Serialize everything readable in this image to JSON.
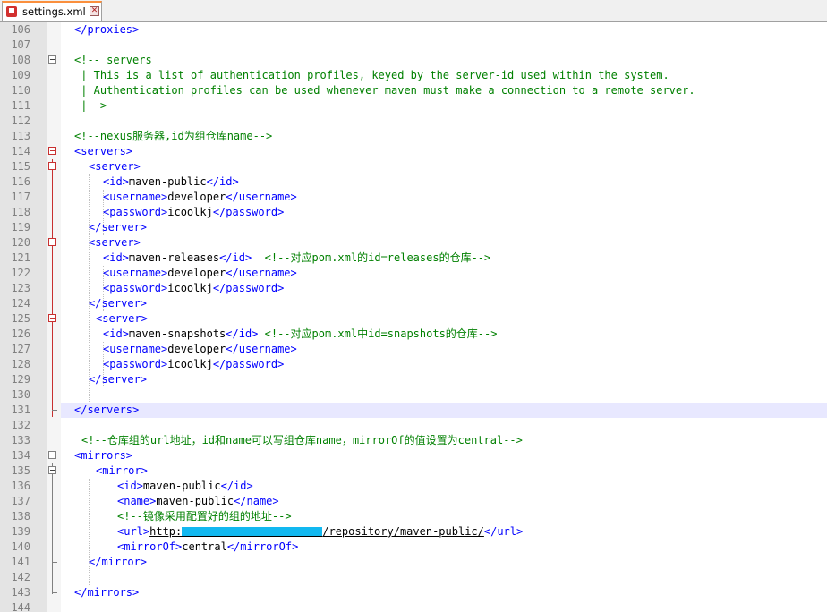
{
  "tab": {
    "filename": "settings.xml",
    "close_glyph": "✕"
  },
  "lines": {
    "106": {
      "num": "106",
      "a": "</proxies>"
    },
    "107": {
      "num": "107"
    },
    "108": {
      "num": "108",
      "a": "<!-- servers"
    },
    "109": {
      "num": "109",
      "a": " | This is a list of authentication profiles, keyed by the server-id used within the system."
    },
    "110": {
      "num": "110",
      "a": " | Authentication profiles can be used whenever maven must make a connection to a remote server."
    },
    "111": {
      "num": "111",
      "a": " |-->"
    },
    "112": {
      "num": "112"
    },
    "113": {
      "num": "113",
      "a": "<!--nexus服务器,id为组仓库name-->"
    },
    "114": {
      "num": "114",
      "a": "<servers>"
    },
    "115": {
      "num": "115",
      "a": "<server>"
    },
    "116": {
      "num": "116",
      "o": "<id>",
      "v": "maven-public",
      "c": "</id>"
    },
    "117": {
      "num": "117",
      "o": "<username>",
      "v": "developer",
      "c": "</username>"
    },
    "118": {
      "num": "118",
      "o": "<password>",
      "v": "icoolkj",
      "c": "</password>"
    },
    "119": {
      "num": "119",
      "a": "</server>"
    },
    "120": {
      "num": "120",
      "a": "<server>"
    },
    "121": {
      "num": "121",
      "o": "<id>",
      "v": "maven-releases",
      "c": "</id>",
      "cm": "  <!--对应pom.xml的id=releases的仓库-->"
    },
    "122": {
      "num": "122",
      "o": "<username>",
      "v": "developer",
      "c": "</username>"
    },
    "123": {
      "num": "123",
      "o": "<password>",
      "v": "icoolkj",
      "c": "</password>"
    },
    "124": {
      "num": "124",
      "a": "</server>"
    },
    "125": {
      "num": "125",
      "a": "<server>"
    },
    "126": {
      "num": "126",
      "o": "<id>",
      "v": "maven-snapshots",
      "c": "</id>",
      "cm": " <!--对应pom.xml中id=snapshots的仓库-->"
    },
    "127": {
      "num": "127",
      "o": "<username>",
      "v": "developer",
      "c": "</username>"
    },
    "128": {
      "num": "128",
      "o": "<password>",
      "v": "icoolkj",
      "c": "</password>"
    },
    "129": {
      "num": "129",
      "a": "</server>"
    },
    "130": {
      "num": "130"
    },
    "131": {
      "num": "131",
      "a": "</servers>"
    },
    "132": {
      "num": "132"
    },
    "133": {
      "num": "133",
      "a": "<!--仓库组的url地址，id和name可以写组仓库name，mirrorOf的值设置为central-->"
    },
    "134": {
      "num": "134",
      "a": "<mirrors>"
    },
    "135": {
      "num": "135",
      "a": "<mirror>"
    },
    "136": {
      "num": "136",
      "o": "<id>",
      "v": "maven-public",
      "c": "</id>"
    },
    "137": {
      "num": "137",
      "o": "<name>",
      "v": "maven-public",
      "c": "</name>"
    },
    "138": {
      "num": "138",
      "a": "<!--镜像采用配置好的组的地址-->"
    },
    "139": {
      "num": "139",
      "o": "<url>",
      "v": "http:",
      "v2": "/repository/maven-public/",
      "c": "</url>"
    },
    "140": {
      "num": "140",
      "o": "<mirrorOf>",
      "v": "central",
      "c": "</mirrorOf>"
    },
    "141": {
      "num": "141",
      "a": "</mirror>"
    },
    "142": {
      "num": "142"
    },
    "143": {
      "num": "143",
      "a": "</mirrors>"
    },
    "144": {
      "num": "144"
    }
  }
}
